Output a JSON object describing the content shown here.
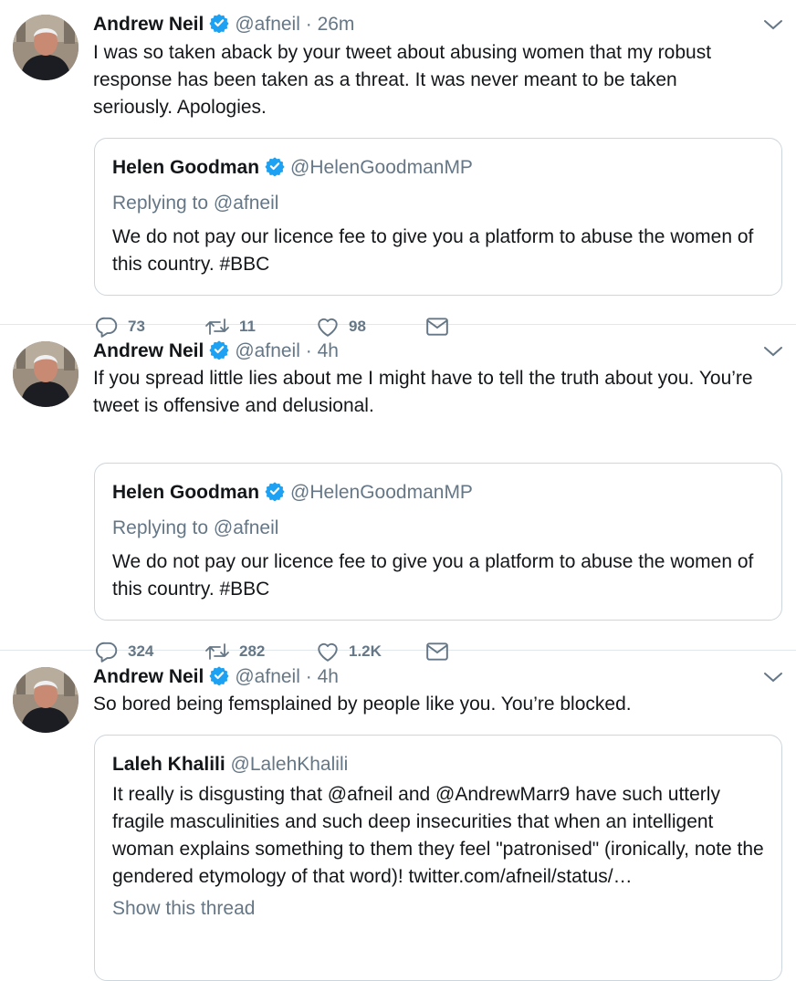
{
  "tweets": [
    {
      "name": "Andrew Neil",
      "handle": "@afneil",
      "dot": "·",
      "time": "26m",
      "text": "I was so taken aback by your tweet about abusing women that my robust response has been taken as a threat. It was never meant to be taken seriously. Apologies.",
      "quote": {
        "name": "Helen Goodman",
        "handle": "@HelenGoodmanMP",
        "replying": "Replying to @afneil",
        "text": "We do not pay our licence fee to give you a platform to abuse the women of this country. #BBC"
      },
      "actions": {
        "replies": "73",
        "retweets": "11",
        "likes": "98"
      }
    },
    {
      "name": "Andrew Neil",
      "handle": "@afneil",
      "dot": "·",
      "time": "4h",
      "text": "If you spread little lies about me I might have to tell the truth about you. You’re tweet is offensive and delusional.",
      "quote": {
        "name": "Helen Goodman",
        "handle": "@HelenGoodmanMP",
        "replying": "Replying to @afneil",
        "text": "We do not pay our licence fee to give you a platform to abuse the women of this country. #BBC"
      },
      "actions": {
        "replies": "324",
        "retweets": "282",
        "likes": "1.2K"
      }
    },
    {
      "name": "Andrew Neil",
      "handle": "@afneil",
      "dot": "·",
      "time": "4h",
      "text": "So bored being femsplained by people like you. You’re blocked.",
      "quote": {
        "name": "Laleh Khalili",
        "handle": "@LalehKhalili",
        "text": "It really is disgusting that @afneil and @AndrewMarr9 have such utterly fragile masculinities and such deep insecurities that when an intelligent woman explains something to them they feel \"patronised\" (ironically, note the gendered etymology of that word)! twitter.com/afneil/status/…",
        "show_thread": "Show this thread"
      }
    }
  ],
  "colors": {
    "verified": "#1da1f2",
    "muted": "#657786",
    "border": "#ccd6dd"
  },
  "icons": [
    "reply-icon",
    "retweet-icon",
    "like-icon",
    "direct-message-icon",
    "verified-badge-icon",
    "chevron-down-icon"
  ]
}
